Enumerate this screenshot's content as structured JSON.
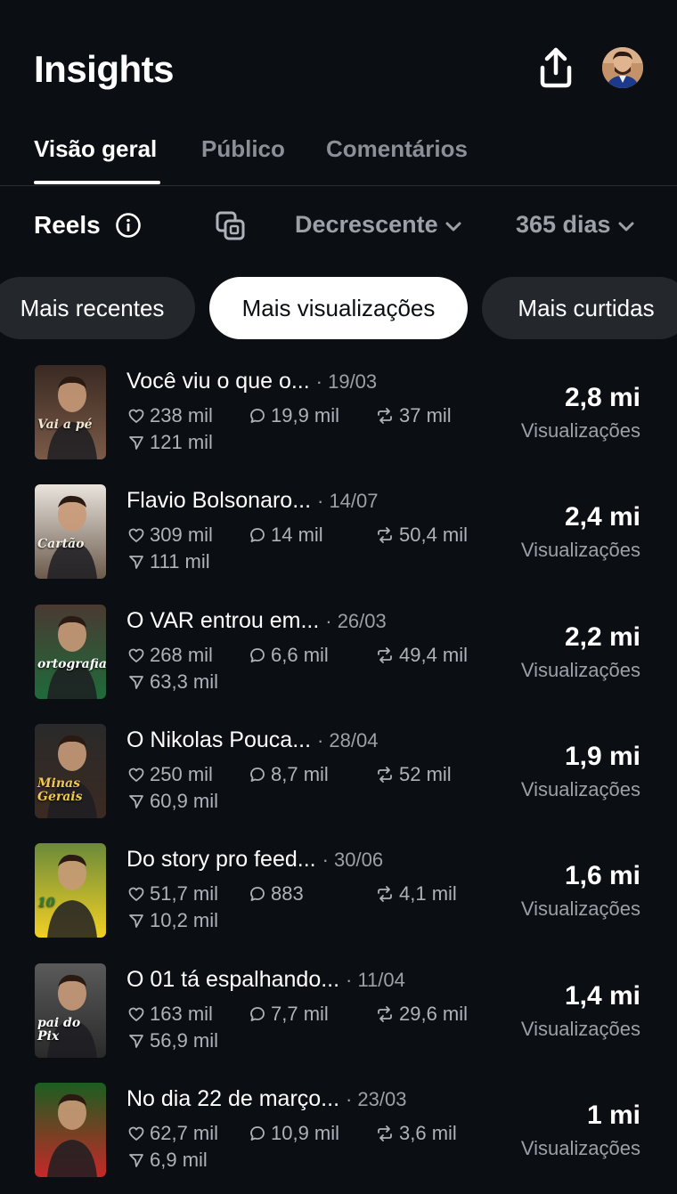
{
  "header": {
    "title": "Insights"
  },
  "tabs": [
    {
      "label": "Visão geral",
      "active": true
    },
    {
      "label": "Público",
      "active": false
    },
    {
      "label": "Comentários",
      "active": false
    }
  ],
  "controls": {
    "section_label": "Reels",
    "sort_label": "Decrescente",
    "period_label": "365 dias"
  },
  "chips": [
    {
      "label": "Mais recentes",
      "active": false
    },
    {
      "label": "Mais visualizações",
      "active": true
    },
    {
      "label": "Mais curtidas",
      "active": false
    }
  ],
  "reels": [
    {
      "title": "Você viu o que o...",
      "date": "· 19/03",
      "likes": "238 mil",
      "comments": "19,9 mil",
      "reposts": "37 mil",
      "shares": "121 mil",
      "views": "2,8 mi",
      "views_label": "Visualizações",
      "thumb_text": "Vai a pé"
    },
    {
      "title": "Flavio Bolsonaro...",
      "date": "· 14/07",
      "likes": "309 mil",
      "comments": "14 mil",
      "reposts": "50,4 mil",
      "shares": "111 mil",
      "views": "2,4 mi",
      "views_label": "Visualizações",
      "thumb_text": "Cartão"
    },
    {
      "title": "O VAR entrou em...",
      "date": "· 26/03",
      "likes": "268 mil",
      "comments": "6,6 mil",
      "reposts": "49,4 mil",
      "shares": "63,3 mil",
      "views": "2,2 mi",
      "views_label": "Visualizações",
      "thumb_text": "ortografia"
    },
    {
      "title": "O Nikolas Pouca...",
      "date": "· 28/04",
      "likes": "250 mil",
      "comments": "8,7 mil",
      "reposts": "52 mil",
      "shares": "60,9 mil",
      "views": "1,9 mi",
      "views_label": "Visualizações",
      "thumb_text": "Minas Gerais"
    },
    {
      "title": "Do story pro feed...",
      "date": "· 30/06",
      "likes": "51,7 mil",
      "comments": "883",
      "reposts": "4,1 mil",
      "shares": "10,2 mil",
      "views": "1,6 mi",
      "views_label": "Visualizações",
      "thumb_text": "10"
    },
    {
      "title": "O 01 tá espalhando...",
      "date": "· 11/04",
      "likes": "163 mil",
      "comments": "7,7 mil",
      "reposts": "29,6 mil",
      "shares": "56,9 mil",
      "views": "1,4 mi",
      "views_label": "Visualizações",
      "thumb_text": "pai do Pix"
    },
    {
      "title": "No dia 22 de março...",
      "date": "· 23/03",
      "likes": "62,7 mil",
      "comments": "10,9 mil",
      "reposts": "3,6 mil",
      "shares": "6,9 mil",
      "views": "1 mi",
      "views_label": "Visualizações",
      "thumb_text": ""
    }
  ],
  "colors": {
    "background": "#0b0e12",
    "chip": "#24282d",
    "muted": "#9ca1a8"
  }
}
